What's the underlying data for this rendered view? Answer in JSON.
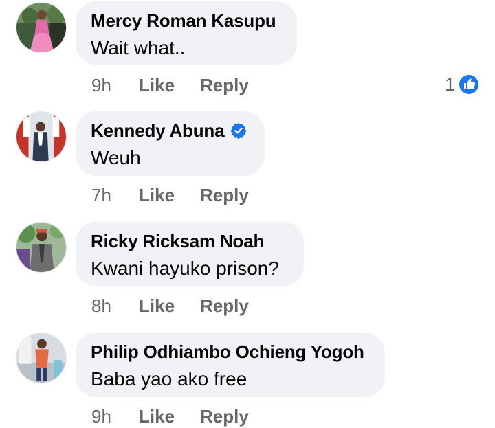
{
  "comments": [
    {
      "author": "Mercy Roman Kasupu",
      "verified": false,
      "text": "Wait what..",
      "time": "9h",
      "like_label": "Like",
      "reply_label": "Reply",
      "reaction_count": "1",
      "reaction_icon": "like-reaction-icon"
    },
    {
      "author": "Kennedy Abuna",
      "verified": true,
      "text": "Weuh",
      "time": "7h",
      "like_label": "Like",
      "reply_label": "Reply"
    },
    {
      "author": "Ricky Ricksam Noah",
      "verified": false,
      "text": "Kwani hayuko prison?",
      "time": "8h",
      "like_label": "Like",
      "reply_label": "Reply"
    },
    {
      "author": "Philip Odhiambo Ochieng Yogoh",
      "verified": false,
      "text": "Baba yao ako free",
      "time": "9h",
      "like_label": "Like",
      "reply_label": "Reply"
    }
  ],
  "colors": {
    "bubble_bg": "#f0f2f5",
    "meta_text": "#65676b",
    "facebook_blue": "#1877f2"
  }
}
